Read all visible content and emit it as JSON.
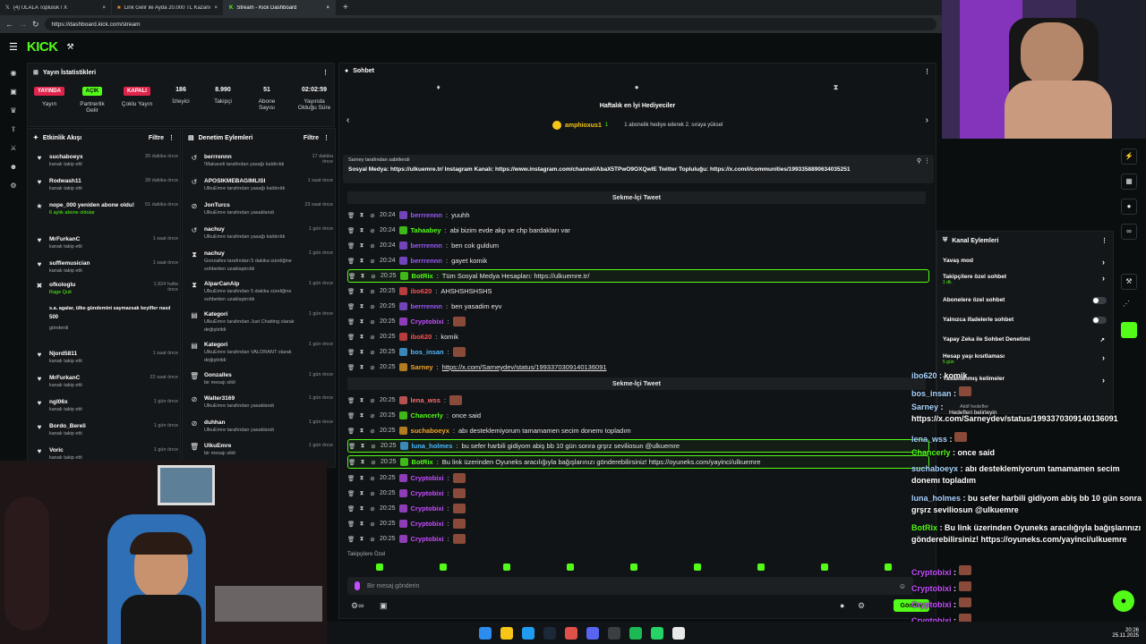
{
  "browser": {
    "tabs": [
      {
        "label": "(4) ULALA Topluluk / X"
      },
      {
        "label": "Link Gelir ile Ayda 20.000 TL Kazanc"
      },
      {
        "label": "Stream - Kick Dashboard"
      }
    ],
    "url": "https://dashboard.kick.com/stream"
  },
  "brand": {
    "logo": "KICK",
    "accent": "#53fc18"
  },
  "stats": {
    "title": "Yayın İstatistikleri",
    "live_badge": "YAYINDA",
    "live_label": "Yayın",
    "partner_badge": "AÇIK",
    "partner_label": "Partnerlik Gelir",
    "multi_badge": "KAPALI",
    "multi_label": "Çoklu Yayın",
    "viewers": "186",
    "viewers_label": "İzleyici",
    "followers": "8.990",
    "followers_label": "Takipçi",
    "subs": "51",
    "subs_label": "Abone Sayısı",
    "uptime": "02:02:59",
    "uptime_label": "Yayında Olduğu Süre"
  },
  "activity": {
    "title": "Etkinlik Akışı",
    "filter": "Filtre",
    "items": [
      {
        "user": "suchaboeyx",
        "action": "kanalı takip etti",
        "time": "20 dakika önce",
        "icon": "heart-icon"
      },
      {
        "user": "Rodwash11",
        "action": "kanalı takip etti",
        "time": "28 dakika önce",
        "icon": "heart-icon"
      },
      {
        "user": "nope_000 yeniden abone oldu!",
        "action": "6 aylık abone oldular",
        "time": "51 dakika önce",
        "icon": "star-icon"
      },
      {
        "user": "MrFurkanC",
        "action": "kanalı takip etti",
        "time": "1 saat önce",
        "icon": "heart-icon"
      },
      {
        "user": "sufflemusician",
        "action": "kanalı takip etti",
        "time": "1 saat önce",
        "icon": "heart-icon"
      },
      {
        "user": "ofkologlu",
        "action": "Rage Quit",
        "time": "1.924 hafta önce",
        "icon": "x-icon"
      },
      {
        "user": "s.a. agalar, ülke gündemini saymazsak keyifler nasıl",
        "action": "gönderdi",
        "time": "",
        "icon": "",
        "amount": "500"
      },
      {
        "user": "Njord5811",
        "action": "kanalı takip etti",
        "time": "1 saat önce",
        "icon": "heart-icon"
      },
      {
        "user": "MrFurkanC",
        "action": "kanalı takip etti",
        "time": "22 saat önce",
        "icon": "heart-icon"
      },
      {
        "user": "ngl06x",
        "action": "kanalı takip etti",
        "time": "1 gün önce",
        "icon": "heart-icon"
      },
      {
        "user": "Bordo_Bereli",
        "action": "kanalı takip etti",
        "time": "1 gün önce",
        "icon": "heart-icon"
      },
      {
        "user": "Voric",
        "action": "kanalı takip etti",
        "time": "1 gün önce",
        "icon": "heart-icon"
      }
    ]
  },
  "moderation": {
    "title": "Denetim Eylemleri",
    "filter": "Filtre",
    "items": [
      {
        "user": "berrrennn",
        "action": "!Makaveli tarafından yasağı kaldırıldı",
        "time": "17 dakika önce",
        "icon": "undo-icon"
      },
      {
        "user": "APOSIKMEBAGIMLISI",
        "action": "UlkuEmre tarafından yasağı kaldırıldı",
        "time": "1 saat önce",
        "icon": "undo-icon"
      },
      {
        "user": "JonTurcs",
        "action": "UlkuEmre tarafından yasaklandı",
        "time": "23 saat önce",
        "icon": "ban-icon"
      },
      {
        "user": "nachuy",
        "action": "UlkuEmre tarafından yasağı kaldırıldı",
        "time": "1 gün önce",
        "icon": "undo-icon"
      },
      {
        "user": "nachuy",
        "action": "Gonzalles tarafından 5 dakika süreliğine sohbetten uzaklaştırıldı",
        "time": "1 gün önce",
        "icon": "hourglass-icon"
      },
      {
        "user": "AlparCanAlp",
        "action": "UlkuEmre tarafından 5 dakika süreliğine sohbetten uzaklaştırıldı",
        "time": "1 gün önce",
        "icon": "hourglass-icon"
      },
      {
        "user": "Kategori",
        "action": "UlkuEmre tarafından Just Chatting olarak değiştirildi",
        "time": "1 gün önce",
        "icon": "category-icon"
      },
      {
        "user": "Kategori",
        "action": "UlkuEmre tarafından VALORANT olarak değiştirildi",
        "time": "1 gün önce",
        "icon": "category-icon"
      },
      {
        "user": "Gonzalles",
        "action": "bir mesajı sildi",
        "time": "1 gün önce",
        "icon": "trash-icon"
      },
      {
        "user": "Walter3169",
        "action": "UlkuEmre tarafından yasaklandı",
        "time": "1 gün önce",
        "icon": "ban-icon"
      },
      {
        "user": "duhhan",
        "action": "UlkuEmre tarafından yasaklandı",
        "time": "1 gün önce",
        "icon": "ban-icon"
      },
      {
        "user": "UlkuEmre",
        "action": "bir mesajı sildi",
        "time": "1 gün önce",
        "icon": "trash-icon"
      }
    ]
  },
  "chat": {
    "title": "Sohbet",
    "gifters_title": "Haftalık en İyi Hediyeciler",
    "top_gifter": "amphioxus1",
    "top_gifter_count": "1",
    "gifter_hint": "1 abonelik hediye ederek 2. sıraya yüksel",
    "pinned_by": "Sarney tarafından sabitlendi",
    "pinned_text": "Sosyal Medya: https://ulkuemre.tr/ Instagram Kanalı: https://www.instagram.com/channel/AbaX5TPwO9OXQwIE Twitter Topluluğu: https://x.com/i/communities/1993358890634035251",
    "sep1": "Sekme-İçi Tweet",
    "sep2": "Sekme-İçi Tweet",
    "messages": [
      {
        "time": "20:24",
        "user": "berrrennn",
        "text": "yuuhh",
        "color": "#9b59ff"
      },
      {
        "time": "20:24",
        "user": "Tahaabey",
        "text": "abi bizim evde akp ve chp bardakları var",
        "color": "#53fc18"
      },
      {
        "time": "20:24",
        "user": "berrrennn",
        "text": "ben cok guldum",
        "color": "#9b59ff"
      },
      {
        "time": "20:24",
        "user": "berrrennn",
        "text": "gayet komik",
        "color": "#9b59ff"
      },
      {
        "time": "20:25",
        "user": "BotRix",
        "text": "Tüm Sosyal Medya Hesapları: https://ulkuemre.tr/",
        "color": "#53fc18"
      },
      {
        "time": "20:25",
        "user": "ibo620",
        "text": "AHSHSHSHSHS",
        "color": "#ff4d4d"
      },
      {
        "time": "20:25",
        "user": "berrrennn",
        "text": "ben yasadim eyv",
        "color": "#9b59ff"
      },
      {
        "time": "20:25",
        "user": "Cryptobixi",
        "text": "",
        "color": "#c44dff"
      },
      {
        "time": "20:25",
        "user": "ibo620",
        "text": "komik",
        "color": "#ff4d4d"
      },
      {
        "time": "20:25",
        "user": "bos_insan",
        "text": "",
        "color": "#4db8ff"
      },
      {
        "time": "20:25",
        "user": "Sarney",
        "text": "https://x.com/Sarneydev/status/1993370309140136091",
        "color": "#f5a623"
      },
      {
        "time": "20:25",
        "user": "lena_wss",
        "text": "",
        "color": "#ff6b6b"
      },
      {
        "time": "20:25",
        "user": "Chancerly",
        "text": "once said",
        "color": "#53fc18"
      },
      {
        "time": "20:25",
        "user": "suchaboeyx",
        "text": "abı desteklemiyorum tamamamen secim donemı topladım",
        "color": "#f5a623"
      },
      {
        "time": "20:25",
        "user": "luna_holmes",
        "text": "bu sefer harbili gidiyom abiş bb 10 gün sonra grşrz seviliosun @ulkuemre",
        "color": "#4db8ff"
      },
      {
        "time": "20:25",
        "user": "BotRix",
        "text": "Bu link üzerinden Oyuneks aracılığıyla bağışlarınızı gönderebilirsiniz! https://oyuneks.com/yayinci/ulkuemre",
        "color": "#53fc18"
      },
      {
        "time": "20:25",
        "user": "Cryptobixi",
        "text": "",
        "color": "#c44dff"
      },
      {
        "time": "20:25",
        "user": "Cryptobixi",
        "text": "",
        "color": "#c44dff"
      },
      {
        "time": "20:25",
        "user": "Cryptobixi",
        "text": "",
        "color": "#c44dff"
      },
      {
        "time": "20:25",
        "user": "Cryptobixi",
        "text": "",
        "color": "#c44dff"
      },
      {
        "time": "20:25",
        "user": "Cryptobixi",
        "text": "",
        "color": "#c44dff"
      }
    ],
    "followers_only": "Takipçilere Özel",
    "input_placeholder": "Bir mesaj gönderin",
    "send": "Gönder"
  },
  "channel_actions": {
    "title": "Kanal Eylemleri",
    "items": [
      {
        "label": "Yavaş mod"
      },
      {
        "label": "Takipçilere özel sohbet",
        "sub": "1 dk."
      },
      {
        "label": "Abonelere özel sohbet"
      },
      {
        "label": "Yalnızca ifadelerle sohbet"
      },
      {
        "label": "Yapay Zeka ile Sohbet Denetimi"
      },
      {
        "label": "Hesap yaşı kısıtlaması",
        "sub": "5 gün"
      },
      {
        "label": "Yasaklanmış kelimeler"
      }
    ],
    "goal_label": "Aktif hedefler",
    "goal_text": "Hedefleri belirleyin"
  },
  "overlay_chat": [
    {
      "user": "ibo620",
      "text": "komik"
    },
    {
      "user": "bos_insan",
      "text": ""
    },
    {
      "user": "Sarney",
      "text": "https://x.com/Sarneydev/status/1993370309140136091"
    },
    {
      "user": "lena_wss",
      "text": ""
    },
    {
      "user": "Chancerly",
      "text": "once said"
    },
    {
      "user": "suchaboeyx",
      "text": "abı desteklemiyorum tamamamen secim donemı topladım"
    },
    {
      "user": "luna_holmes",
      "text": "bu sefer harbili gidiyom abiş bb 10 gün sonra grşrz seviliosun @ulkuemre"
    },
    {
      "user": "BotRix",
      "text": "Bu link üzerinden Oyuneks aracılığıyla bağışlarınızı gönderebilirsiniz! https://oyuneks.com/yayinci/ulkuemre"
    },
    {
      "user": "Cryptobixi",
      "text": ""
    },
    {
      "user": "Cryptobixi",
      "text": ""
    },
    {
      "user": "Cryptobixi",
      "text": ""
    },
    {
      "user": "Cryptobixi",
      "text": ""
    },
    {
      "user": "Cryptobixi",
      "text": ""
    }
  ],
  "clock": {
    "time": "20:26",
    "date": "25.11.2025"
  }
}
